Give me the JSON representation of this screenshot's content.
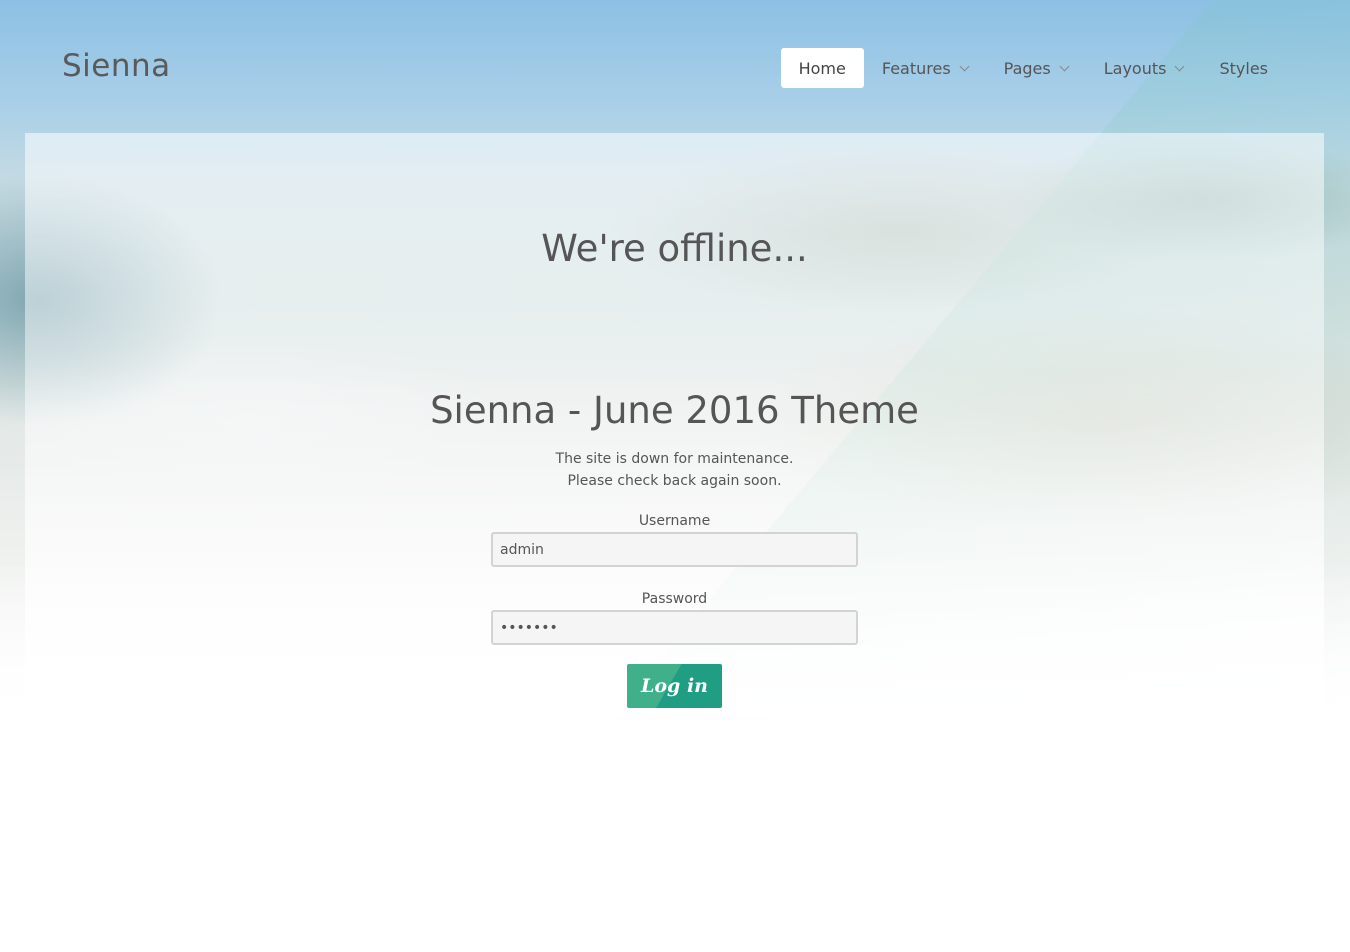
{
  "header": {
    "brand": "Sienna",
    "nav": [
      {
        "label": "Home",
        "active": true,
        "dropdown": false
      },
      {
        "label": "Features",
        "active": false,
        "dropdown": true
      },
      {
        "label": "Pages",
        "active": false,
        "dropdown": true
      },
      {
        "label": "Layouts",
        "active": false,
        "dropdown": true
      },
      {
        "label": "Styles",
        "active": false,
        "dropdown": false
      }
    ]
  },
  "offline": {
    "title": "We're offline...",
    "site_title": "Sienna - June 2016 Theme",
    "message_line1": "The site is down for maintenance.",
    "message_line2": "Please check back again soon."
  },
  "form": {
    "username_label": "Username",
    "username_value": "admin",
    "password_label": "Password",
    "password_value": "•••••••",
    "login_label": "Log in"
  },
  "colors": {
    "accent": "#1f9e83",
    "accent_light": "#3fb08a",
    "text": "#555555",
    "active_nav_bg": "#ffffff"
  }
}
